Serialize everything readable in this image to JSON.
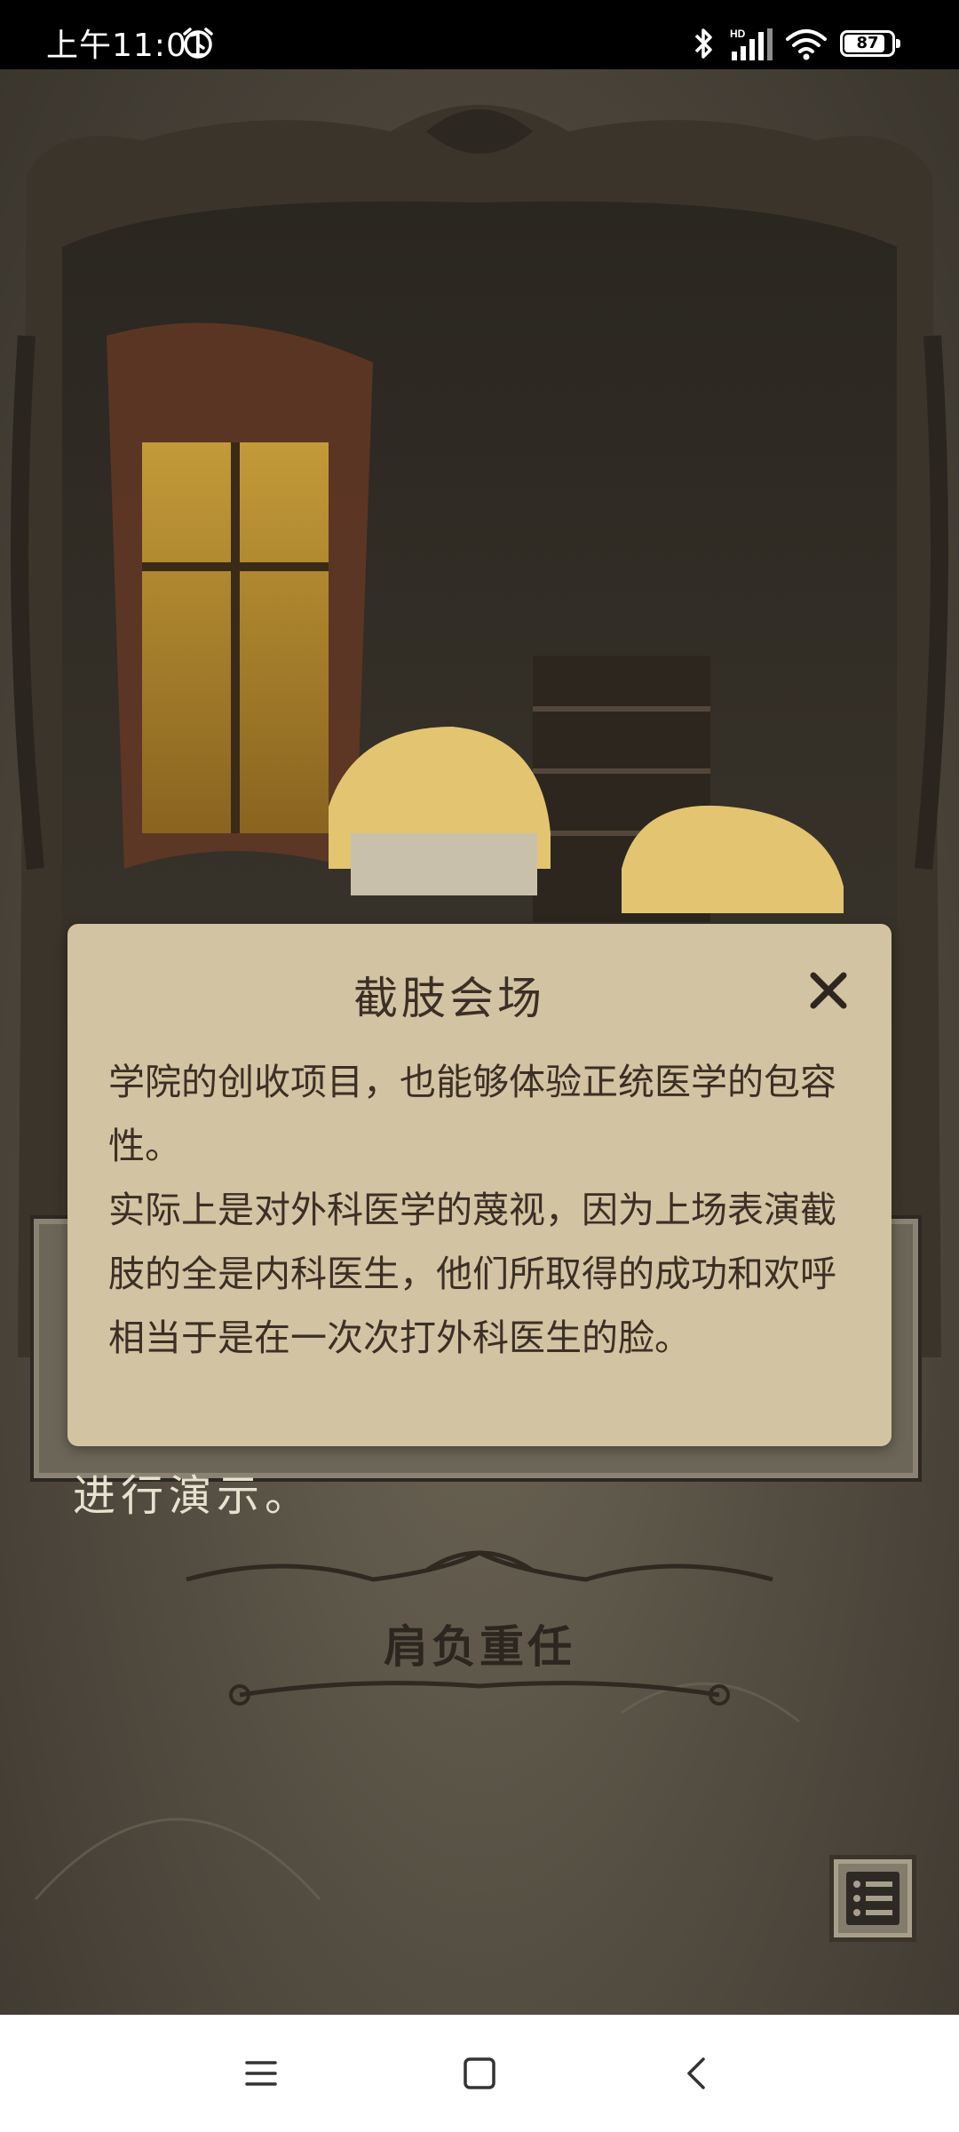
{
  "status_bar": {
    "time": "上午11:01",
    "battery_percent": "87",
    "battery_level": 0.87,
    "icons": [
      "alarm-icon",
      "bluetooth-icon",
      "hd-signal-icon",
      "wifi-icon",
      "battery-icon"
    ]
  },
  "scene": {
    "story_text_visible": "进行演示。",
    "section_title": "肩负重任",
    "menu_icon": "list-icon"
  },
  "dialog": {
    "title": "截肢会场",
    "close_icon": "close-icon",
    "paragraphs": [
      "学院的创收项目，也能够体验正统医学的包容性。",
      "实际上是对外科医学的蔑视，因为上场表演截肢的全是内科医生，他们所取得的成功和欢呼相当于是在一次次打外科医生的脸。"
    ]
  },
  "nav_bar": {
    "icons": [
      "menu-icon",
      "home-icon",
      "back-icon"
    ]
  },
  "colors": {
    "dialog_bg": "#d2c3a2",
    "dialog_text": "#3c2f26",
    "scene_bg": "#4f493e"
  }
}
